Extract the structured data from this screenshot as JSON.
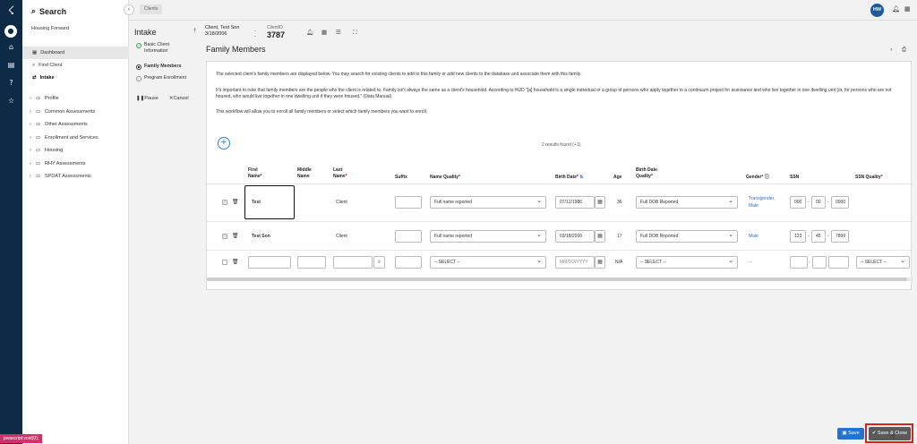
{
  "sidebar": {
    "search_label": "Search",
    "org": "Housing Forward",
    "nav": [
      {
        "label": "Dashboard"
      },
      {
        "label": "Find Client"
      },
      {
        "label": "Intake"
      }
    ],
    "groups": [
      {
        "label": "Profile"
      },
      {
        "label": "Common Assessments"
      },
      {
        "label": "Other Assessments"
      },
      {
        "label": "Enrollment and Services"
      },
      {
        "label": "Housing"
      },
      {
        "label": "RHY Assessments"
      },
      {
        "label": "SPDAT Assessments"
      }
    ]
  },
  "topbar": {
    "breadcrumb": "Clients",
    "avatar_initials": "HW",
    "icons": [
      "bell-icon",
      "grid-icon"
    ]
  },
  "workflow": {
    "title": "Intake",
    "steps": [
      {
        "label": "Basic Client Information",
        "state": "done"
      },
      {
        "label": "Family Members",
        "state": "current"
      },
      {
        "label": "Program Enrollment",
        "state": "pending"
      }
    ],
    "pause_label": "Pause",
    "cancel_label": "Cancel"
  },
  "client_header": {
    "name": "Client, Test Son",
    "dob": "3/18/2006",
    "dash": "--",
    "client_id_label": "ClientID",
    "client_id": "3787"
  },
  "page": {
    "title": "Family Members",
    "intro1": "The selected client's family members are displayed below. You may search for existing clients to add to this family or add new clients to the database and associate them with this family.",
    "intro2": "It's important to note that family members are the people who the client is related to. Family isn't always the same as a client's household. According to HUD \"[a] household is a single individual or a group of persons who apply together to a continuum project for assistance and who live together in one dwelling unit (or, for persons who are not housed, who would live together in one dwelling unit if they were housed.\" (Data Manual)",
    "intro3": "This workflow will allow you to enroll all family members or select which family members you want to enroll.",
    "results": "2 results found (+1).",
    "columns": {
      "first": "First",
      "first2": "Name",
      "middle": "Middle",
      "middle2": "Name",
      "last": "Last",
      "last2": "Name",
      "suffix": "Suffix",
      "name_quality": "Name Quality",
      "birth_date": "Birth Date",
      "age": "Age",
      "bdq": "Birth Date",
      "bdq2": "Quality",
      "gender": "Gender",
      "ssn": "SSN",
      "ssn_quality": "SSN Quality"
    },
    "rows": [
      {
        "first": "Test",
        "last": "Client",
        "name_quality": "Full name reported",
        "birth_date": "07/12/1986",
        "age": "36",
        "bdq": "Full DOB Reported",
        "gender": "Transgender, Male",
        "ssn1": "000",
        "ssn2": "00",
        "ssn3": "0000"
      },
      {
        "first": "Test Son",
        "last": "Client",
        "name_quality": "Full name reported",
        "birth_date": "03/18/2006",
        "age": "17",
        "bdq": "Full DOB Reported",
        "gender": "Male",
        "ssn1": "123",
        "ssn2": "45",
        "ssn3": "7899"
      }
    ],
    "new_row": {
      "name_quality": "-- SELECT --",
      "birth_placeholder": "MM/DD/YYYY",
      "age": "N/A",
      "bdq": "-- SELECT --",
      "gender": "...",
      "ssn_quality": "-- SELECT --",
      "ssn_dash": "-"
    }
  },
  "footer": {
    "status": "javascript:void(0);",
    "save_label": "Save",
    "save_close_label": "Save & Close"
  }
}
